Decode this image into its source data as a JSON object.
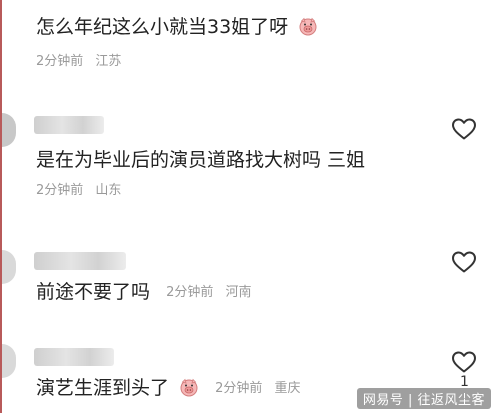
{
  "comments": [
    {
      "text": "怎么年纪这么小就当33姐了呀",
      "time": "2分钟前",
      "location": "江苏",
      "emoji": "pig-face-emoji"
    },
    {
      "text": "是在为毕业后的演员道路找大树吗 三姐",
      "time": "2分钟前",
      "location": "山东"
    },
    {
      "text": "前途不要了吗",
      "time": "2分钟前",
      "location": "河南"
    },
    {
      "text": "演艺生涯到头了",
      "time": "2分钟前",
      "location": "重庆",
      "emoji": "pig-face-emoji",
      "like_count": "1"
    }
  ],
  "watermark": "网易号 | 往返风尘客",
  "icons": {
    "like": "heart-outline-icon"
  },
  "colors": {
    "text": "#222222",
    "meta": "#9a9a9a",
    "edge": "#b85a5a"
  }
}
